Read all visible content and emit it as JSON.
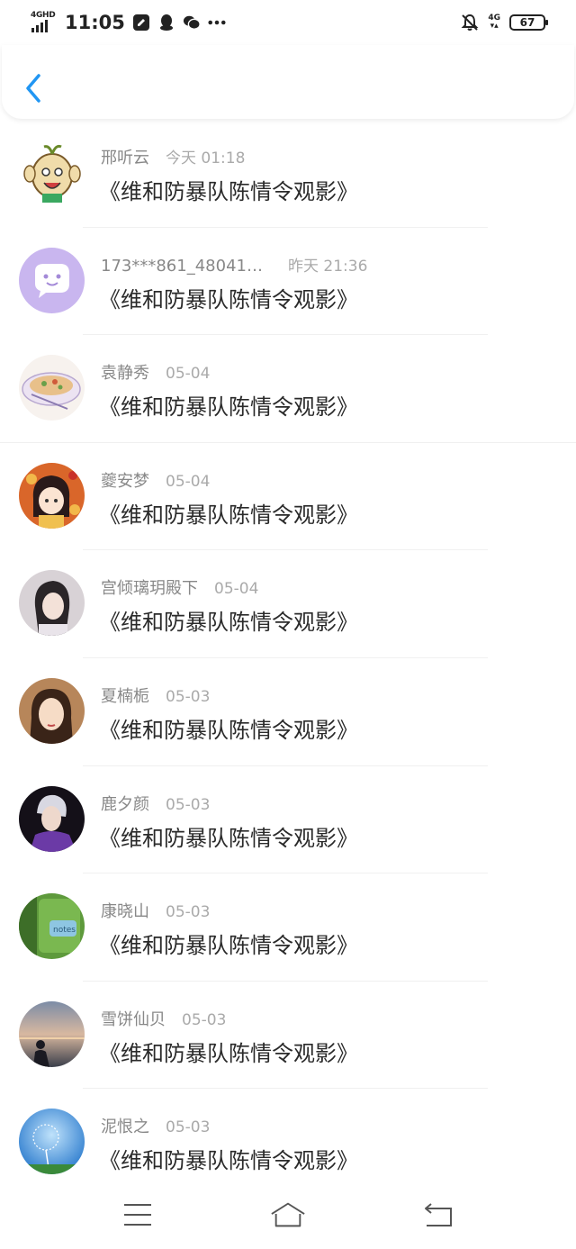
{
  "status_bar": {
    "network": "4GHD",
    "time": "11:05",
    "right_network": "4G",
    "battery": "67",
    "icons": [
      "edit-icon",
      "qq-icon",
      "wechat-icon",
      "more-icon",
      "mute-bell-icon"
    ]
  },
  "header": {
    "back_icon": "chevron-left-icon",
    "accent": "#2196f3"
  },
  "comments": [
    {
      "name": "邢听云",
      "date": "今天 01:18",
      "message": "《维和防暴队陈情令观影》",
      "avatar": "cartoon-avatar"
    },
    {
      "name": "173***861_48041…",
      "date": "昨天 21:36",
      "message": "《维和防暴队陈情令观影》",
      "avatar": "default-chat-avatar"
    },
    {
      "name": "袁静秀",
      "date": "05-04",
      "message": "《维和防暴队陈情令观影》",
      "avatar": "food-avatar"
    },
    {
      "name": "夔安梦",
      "date": "05-04",
      "message": "《维和防暴队陈情令观影》",
      "avatar": "anime-avatar"
    },
    {
      "name": "宫倾璃玥殿下",
      "date": "05-04",
      "message": "《维和防暴队陈情令观影》",
      "avatar": "portrait-avatar"
    },
    {
      "name": "夏楠栀",
      "date": "05-03",
      "message": "《维和防暴队陈情令观影》",
      "avatar": "portrait-avatar"
    },
    {
      "name": "鹿夕颜",
      "date": "05-03",
      "message": "《维和防暴队陈情令观影》",
      "avatar": "portrait-avatar"
    },
    {
      "name": "康晓山",
      "date": "05-03",
      "message": "《维和防暴队陈情令观影》",
      "avatar": "notes-avatar"
    },
    {
      "name": "雪饼仙贝",
      "date": "05-03",
      "message": "《维和防暴队陈情令观影》",
      "avatar": "sunset-avatar"
    },
    {
      "name": "泥恨之",
      "date": "05-03",
      "message": "《维和防暴队陈情令观影》",
      "avatar": "dandelion-avatar"
    }
  ],
  "nav_bar": {
    "icons": [
      "menu-icon",
      "home-icon",
      "back-nav-icon"
    ]
  }
}
